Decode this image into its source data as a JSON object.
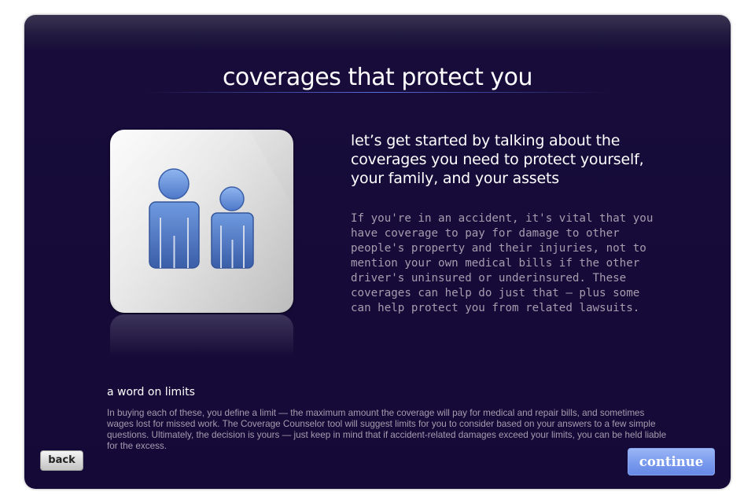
{
  "page": {
    "title": "coverages that protect you",
    "headline": "let’s get started by talking about the coverages you need to protect yourself, your family, and your assets",
    "body": "If you're in an accident, it's vital that you have coverage to pay for damage to other people's property and their injuries, not to mention your own medical bills if the other driver's uninsured or underinsured. These coverages can help do just that — plus some can help protect you from related lawsuits."
  },
  "limits": {
    "heading": "a word on limits",
    "text": "In buying each of these, you define a limit — the maximum amount the coverage will pay for medical and repair bills, and sometimes wages lost for missed work. The Coverage Counselor tool will suggest limits for you to consider based on your answers to a few simple questions. Ultimately, the decision is yours — just keep in mind that if accident-related damages exceed your limits, you can be held liable for the excess."
  },
  "buttons": {
    "back_label": "back",
    "continue_label": "continue"
  },
  "icons": {
    "family": "family-people-icon"
  },
  "colors": {
    "panel_bg": "#150a37",
    "accent_blue": "#7c9cee",
    "body_text": "#a79cae"
  }
}
